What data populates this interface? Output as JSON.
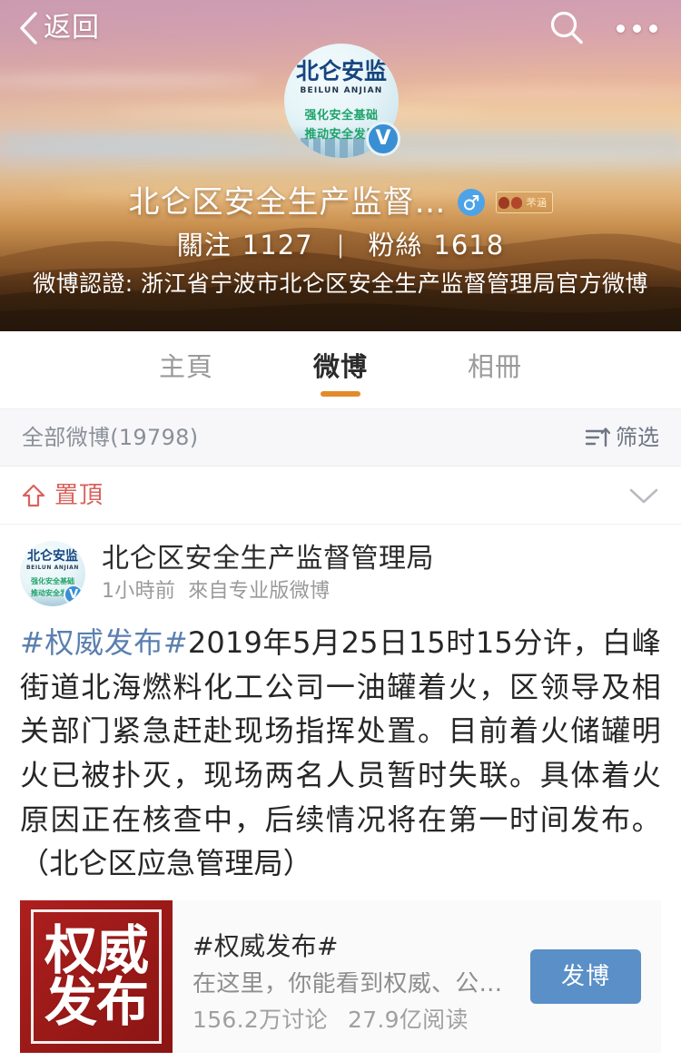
{
  "topbar": {
    "back_label": "返回",
    "back_icon": "chevron-left-icon",
    "search_icon": "search-icon",
    "more_icon": "more-dots-icon"
  },
  "profile": {
    "avatar": {
      "title": "北仑安监",
      "subtitle": "BEILUN ANJIAN",
      "slogan_line1": "强化安全基础",
      "slogan_line2": "推动安全发展",
      "verified_mark": "V"
    },
    "name": "北仑区安全生产监督…",
    "gender_icon": "male-gender-icon",
    "level_badge_text": "芣涵",
    "following_label": "關注",
    "following_count": "1127",
    "separator": "|",
    "followers_label": "粉絲",
    "followers_count": "1618",
    "verification": "微博認證: 浙江省宁波市北仑区安全生产监督管理局官方微博"
  },
  "tabs": [
    {
      "label": "主頁",
      "active": false
    },
    {
      "label": "微博",
      "active": true
    },
    {
      "label": "相冊",
      "active": false
    }
  ],
  "filterbar": {
    "count_label": "全部微博(19798)",
    "filter_icon": "sort-filter-icon",
    "filter_label": "筛选"
  },
  "pinbar": {
    "pin_icon": "pin-top-arrow-icon",
    "pin_label": "置頂",
    "collapse_icon": "chevron-down-icon"
  },
  "post": {
    "avatar": {
      "title": "北仑安监",
      "subtitle": "BEILUN ANJIAN",
      "slogan_line1": "强化安全基础",
      "slogan_line2": "推动安全发展",
      "verified_mark": "V"
    },
    "author": "北仑区安全生产监督管理局",
    "time": "1小時前",
    "source": "來自专业版微博",
    "hashtag": "#权威发布#",
    "text": "2019年5月25日15时15分许，白峰街道北海燃料化工公司一油罐着火，区领导及相关部门紧急赶赴现场指挥处置。目前着火储罐明火已被扑灭，现场两名人员暂时失联。具体着火原因正在核查中，后续情况将在第一时间发布。（北仑区应急管理局）"
  },
  "topic_card": {
    "thumb_line1": "权威",
    "thumb_line2": "发布",
    "title": "#权威发布#",
    "description": "在这里，你能看到权威、公...",
    "discussions": "156.2万讨论",
    "reads": "27.9亿阅读",
    "action_label": "发博"
  },
  "colors": {
    "accent_orange": "#e18b2c",
    "pin_red": "#d9625c",
    "hashtag_blue": "#5a7fb0",
    "button_blue": "#5a8fc7",
    "thumb_red": "#a01a19",
    "verified_blue": "#3a8fd4"
  }
}
